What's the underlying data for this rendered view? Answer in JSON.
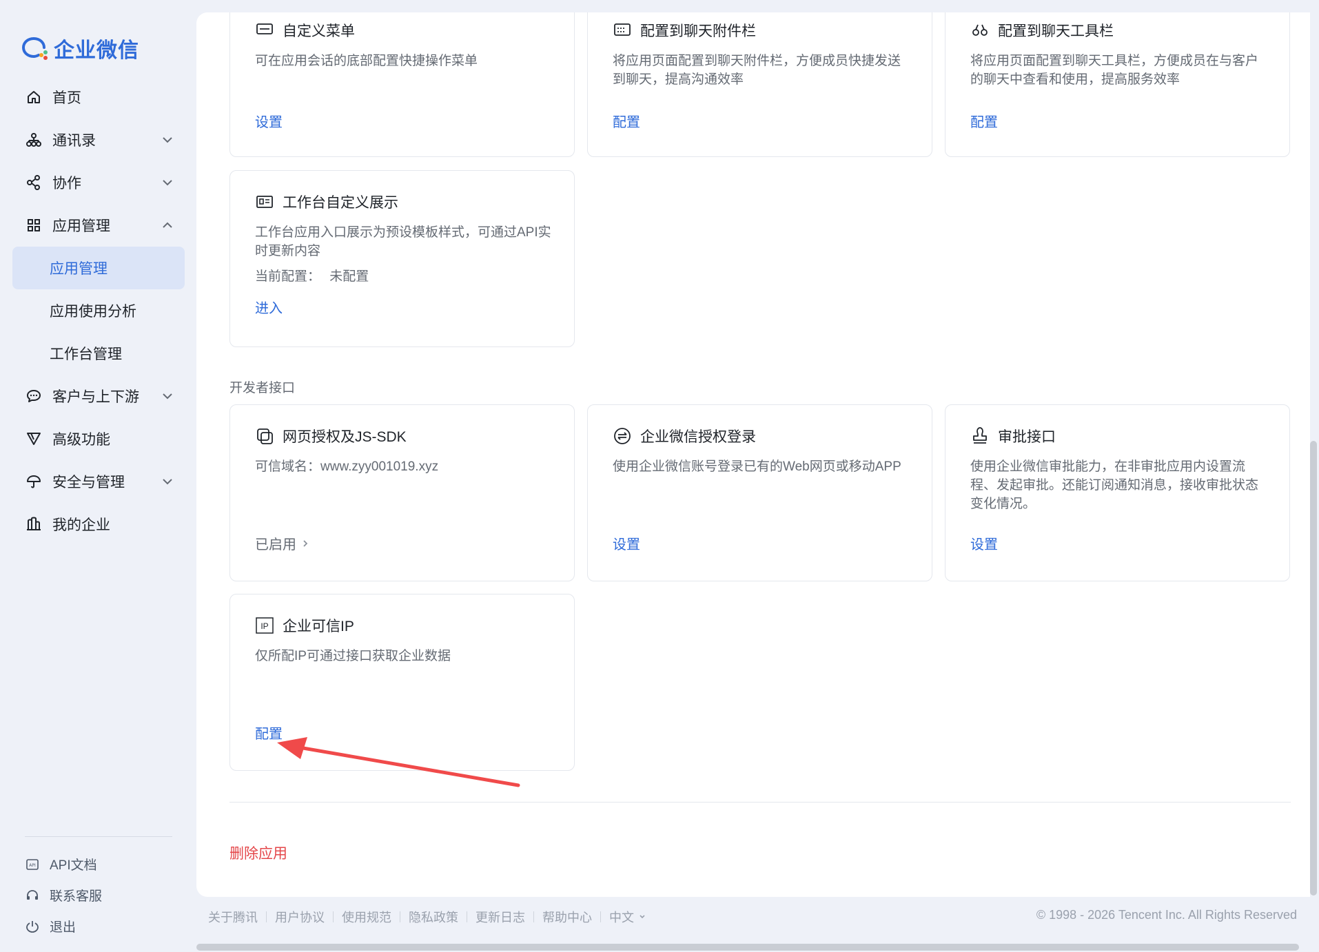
{
  "brand": {
    "name": "企业微信",
    "color": "#2f6bd9"
  },
  "sidebar": {
    "items": [
      {
        "label": "首页",
        "icon": "home-icon"
      },
      {
        "label": "通讯录",
        "icon": "org-icon"
      },
      {
        "label": "协作",
        "icon": "share-icon"
      },
      {
        "label": "应用管理",
        "icon": "grid-icon"
      },
      {
        "label": "客户与上下游",
        "icon": "chat-icon"
      },
      {
        "label": "高级功能",
        "icon": "filter-icon"
      },
      {
        "label": "安全与管理",
        "icon": "umbrella-icon"
      },
      {
        "label": "我的企业",
        "icon": "building-icon"
      }
    ],
    "sub_items": [
      "应用管理",
      "应用使用分析",
      "工作台管理"
    ],
    "bottom": [
      {
        "label": "API文档",
        "icon": "api-icon"
      },
      {
        "label": "联系客服",
        "icon": "headset-icon"
      },
      {
        "label": "退出",
        "icon": "power-icon"
      }
    ]
  },
  "cards_top": [
    {
      "title": "自定义菜单",
      "desc": "可在应用会话的底部配置快捷操作菜单",
      "action": "设置"
    },
    {
      "title": "配置到聊天附件栏",
      "desc": "将应用页面配置到聊天附件栏，方便成员快捷发送到聊天，提高沟通效率",
      "action": "配置"
    },
    {
      "title": "配置到聊天工具栏",
      "desc": "将应用页面配置到聊天工具栏，方便成员在与客户的聊天中查看和使用，提高服务效率",
      "action": "配置"
    }
  ],
  "workbench_card": {
    "title": "工作台自定义展示",
    "desc": "工作台应用入口展示为预设模板样式，可通过API实时更新内容",
    "config_label": "当前配置：",
    "config_value": "未配置",
    "action": "进入"
  },
  "section_dev": "开发者接口",
  "cards_dev": [
    {
      "title": "网页授权及JS-SDK",
      "desc": "可信域名：www.zyy001019.xyz",
      "action": "已启用"
    },
    {
      "title": "企业微信授权登录",
      "desc": "使用企业微信账号登录已有的Web网页或移动APP",
      "action": "设置"
    },
    {
      "title": "审批接口",
      "desc": "使用企业微信审批能力，在非审批应用内设置流程、发起审批。还能订阅通知消息，接收审批状态变化情况。",
      "action": "设置"
    }
  ],
  "ip_card": {
    "title": "企业可信IP",
    "icon_text": "IP",
    "desc": "仅所配IP可通过接口获取企业数据",
    "action": "配置"
  },
  "delete_label": "删除应用",
  "footer": {
    "links": [
      "关于腾讯",
      "用户协议",
      "使用规范",
      "隐私政策",
      "更新日志",
      "帮助中心",
      "中文"
    ],
    "copyright": "© 1998 - 2026 Tencent Inc. All Rights Reserved"
  },
  "annotation_color": "#f04a4a"
}
